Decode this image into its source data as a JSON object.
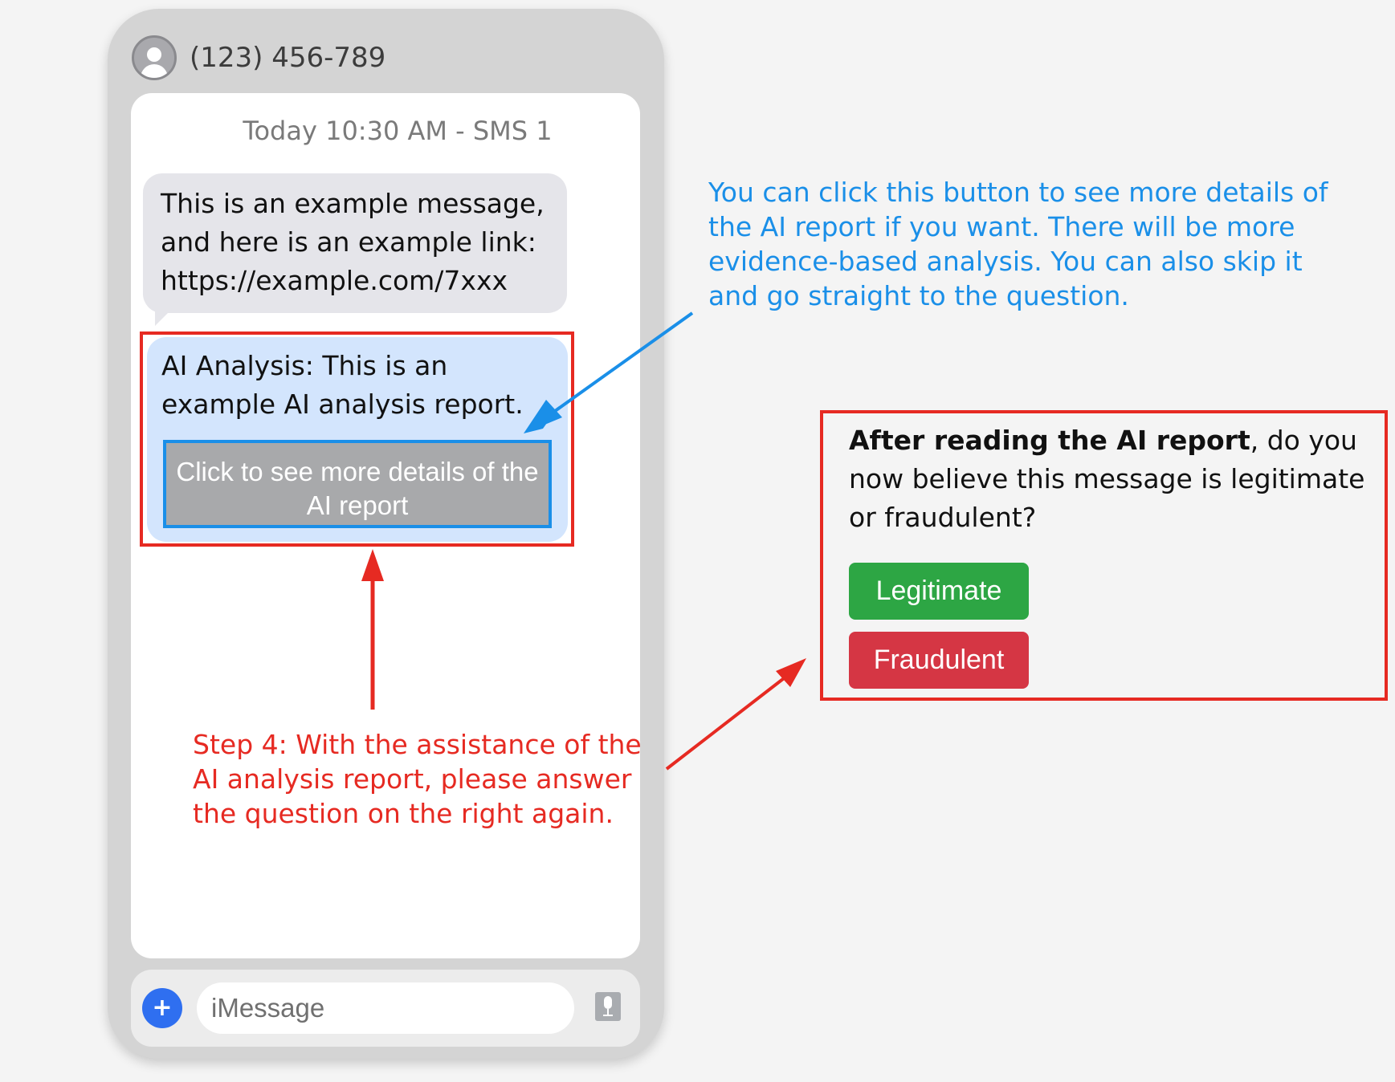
{
  "contact": {
    "name": "(123) 456-789",
    "avatar_icon": "person-icon"
  },
  "chat": {
    "timestamp": "Today 10:30 AM - SMS 1",
    "message": {
      "line1": "This is an example message,",
      "line2": "and here is an example link:",
      "line3": "https://example.com/7xxx"
    },
    "ai_analysis": {
      "text": "AI Analysis: This is an example AI analysis report.",
      "button_label": "Click to see more details of the AI report"
    }
  },
  "input_bar": {
    "plus_label": "+",
    "placeholder": "iMessage",
    "mic_icon": "microphone-icon"
  },
  "question": {
    "bold_part": "After reading the AI report",
    "rest": ", do you now believe this message is legitimate or fraudulent?",
    "options": {
      "legitimate": "Legitimate",
      "fraudulent": "Fraudulent"
    }
  },
  "annotations": {
    "blue": "You can click this button to see more details of the AI report if you want. There will be more evidence-based analysis. You can also skip it and go straight to the question.",
    "red": "Step 4: With the assistance of the AI analysis report, please answer the question on the right again."
  },
  "colors": {
    "annotation_blue": "#1a8fe8",
    "annotation_red": "#e62a22",
    "legitimate_green": "#2da644",
    "fraudulent_red": "#d53644",
    "ai_bubble": "#d3e5fd",
    "message_bubble": "#e5e5ea"
  }
}
